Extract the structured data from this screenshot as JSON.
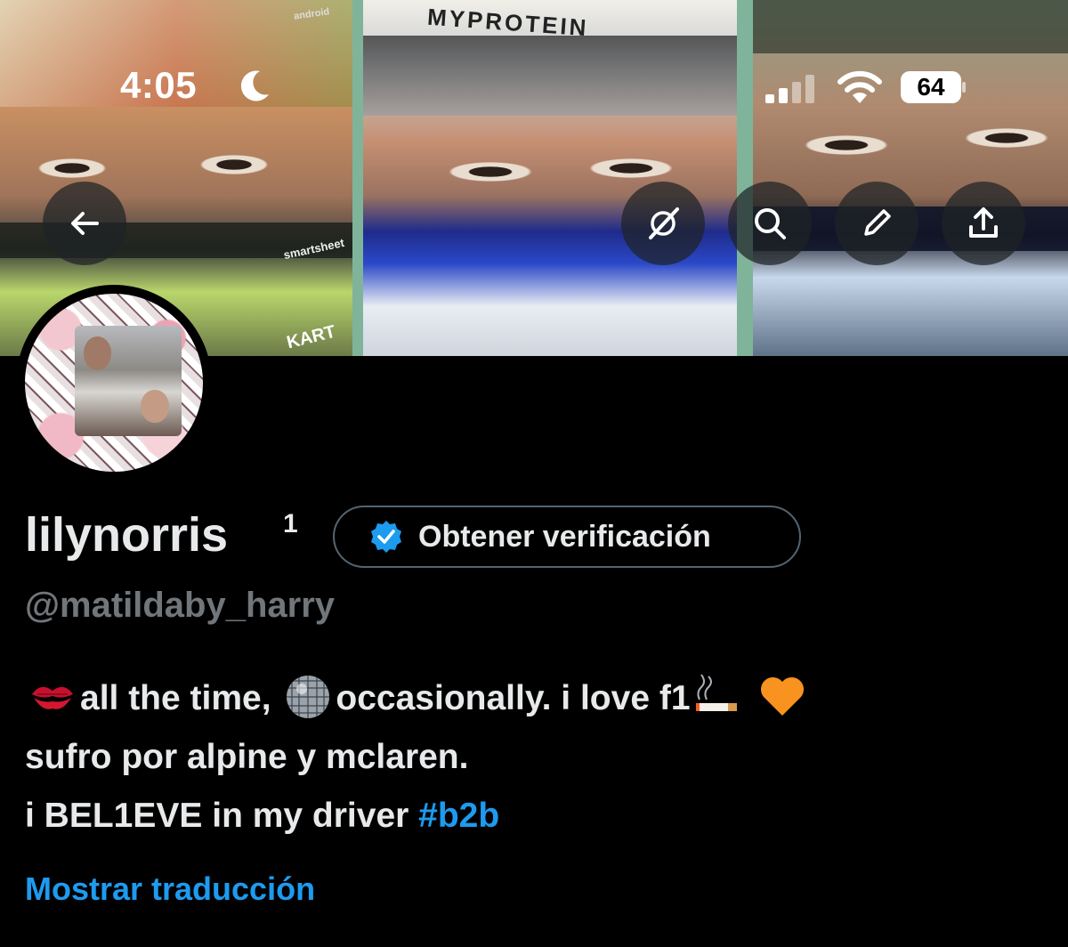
{
  "status_bar": {
    "time": "4:05",
    "battery_level": "64"
  },
  "banner": {
    "brand_text": "MYPROTEIN",
    "side_texts": [
      "android",
      "smartsheet",
      "KART"
    ]
  },
  "toolbar": {
    "icons": [
      "back-arrow-icon",
      "grok-icon",
      "search-icon",
      "edit-icon",
      "share-icon"
    ]
  },
  "profile": {
    "display_name": "lilynorris",
    "name_suffix": "1",
    "verify_button_label": "Obtener verificación",
    "handle": "@matildaby_harry"
  },
  "bio": {
    "line1_text1": "all the time,",
    "line1_text2": "occasionally. i love f1",
    "line2": "sufro por alpine y mclaren.",
    "line3_text": "i BEL1EVE in my driver",
    "line3_hashtag": "#b2b",
    "emojis": [
      "kiss-mark",
      "disco-ball",
      "cigarette",
      "orange-heart"
    ]
  },
  "translate_link": "Mostrar traducción",
  "colors": {
    "background": "#000000",
    "text": "#e7e9ea",
    "secondary_text": "#71767b",
    "link": "#1d9bf0",
    "verify_border": "#536471"
  }
}
